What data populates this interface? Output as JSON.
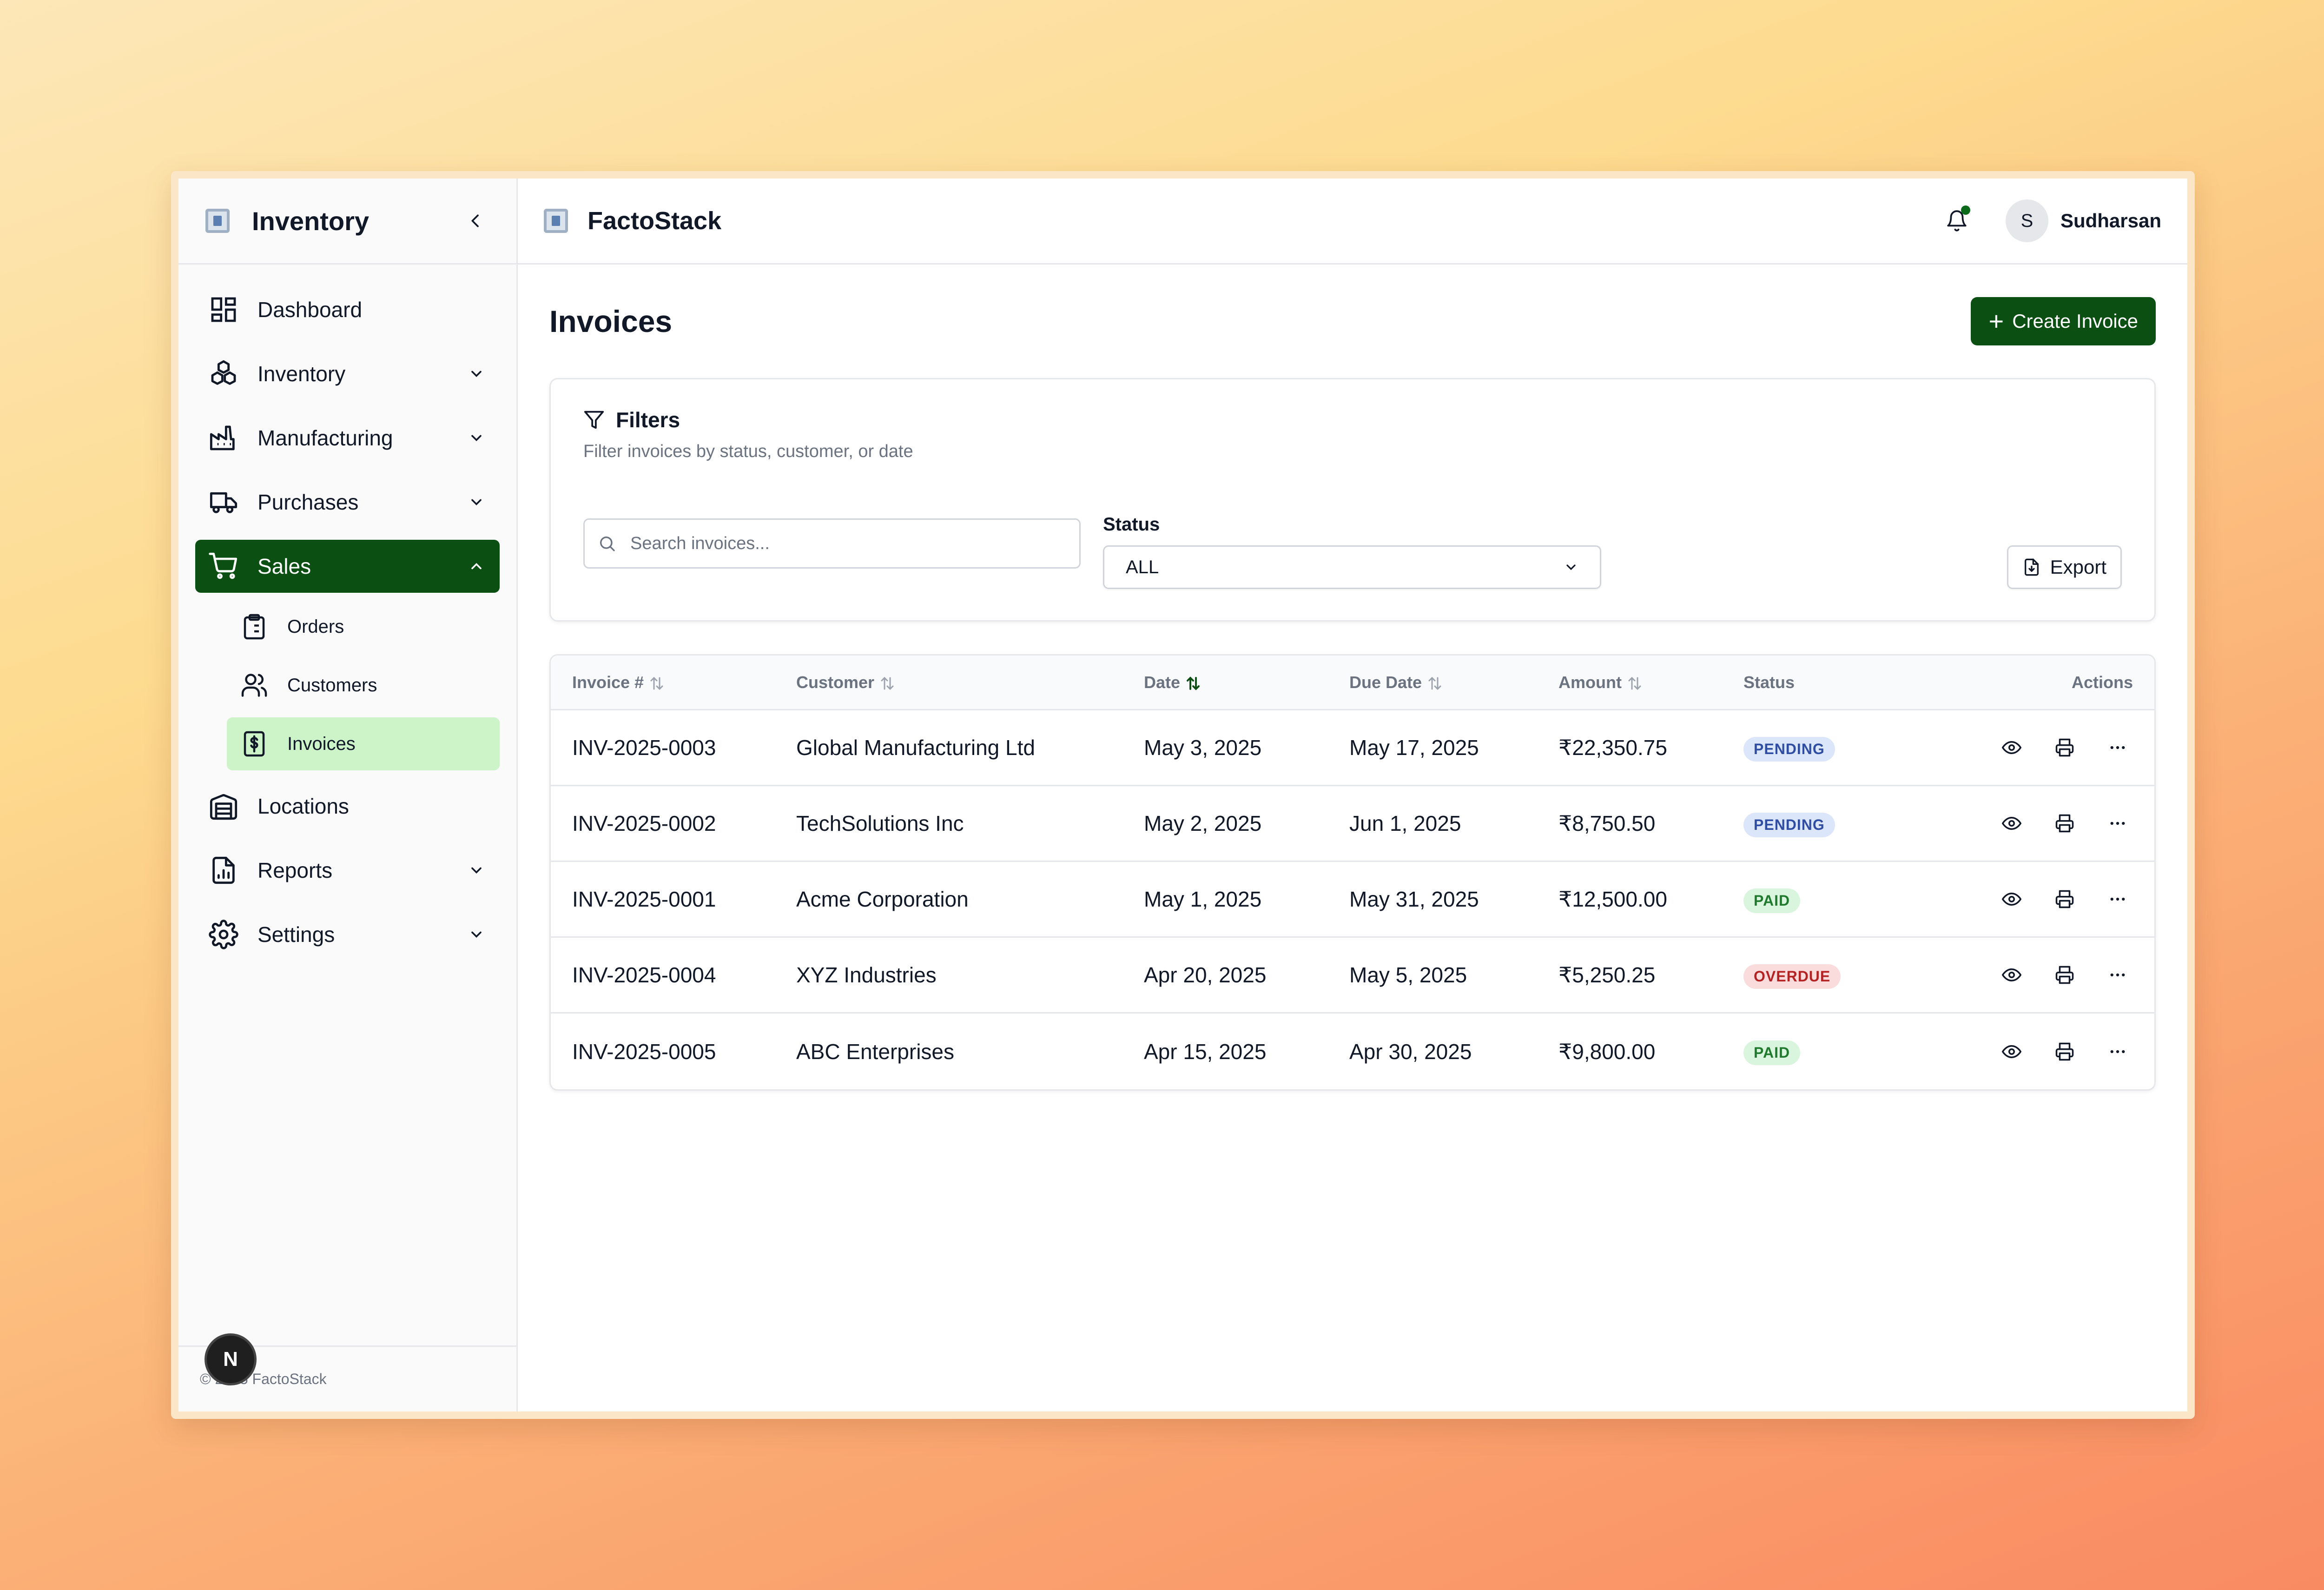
{
  "sidebar": {
    "title": "Inventory",
    "items": [
      {
        "label": "Dashboard"
      },
      {
        "label": "Inventory"
      },
      {
        "label": "Manufacturing"
      },
      {
        "label": "Purchases"
      },
      {
        "label": "Sales"
      },
      {
        "label": "Locations"
      },
      {
        "label": "Reports"
      },
      {
        "label": "Settings"
      }
    ],
    "sales_sub": [
      {
        "label": "Orders"
      },
      {
        "label": "Customers"
      },
      {
        "label": "Invoices"
      }
    ],
    "footer": "© 2025 FactoStack",
    "badge": "N"
  },
  "topbar": {
    "brand": "FactoStack",
    "avatar_initial": "S",
    "user_name": "Sudharsan"
  },
  "page": {
    "title": "Invoices",
    "create_button": "Create Invoice"
  },
  "filters": {
    "title": "Filters",
    "subtitle": "Filter invoices by status, customer, or date",
    "search_placeholder": "Search invoices...",
    "status_label": "Status",
    "status_value": "ALL",
    "export_label": "Export"
  },
  "table": {
    "headers": [
      "Invoice #",
      "Customer",
      "Date",
      "Due Date",
      "Amount",
      "Status",
      "Actions"
    ],
    "rows": [
      {
        "invoice": "INV-2025-0003",
        "customer": "Global Manufacturing Ltd",
        "date": "May 3, 2025",
        "due": "May 17, 2025",
        "amount": "₹22,350.75",
        "status": "PENDING"
      },
      {
        "invoice": "INV-2025-0002",
        "customer": "TechSolutions Inc",
        "date": "May 2, 2025",
        "due": "Jun 1, 2025",
        "amount": "₹8,750.50",
        "status": "PENDING"
      },
      {
        "invoice": "INV-2025-0001",
        "customer": "Acme Corporation",
        "date": "May 1, 2025",
        "due": "May 31, 2025",
        "amount": "₹12,500.00",
        "status": "PAID"
      },
      {
        "invoice": "INV-2025-0004",
        "customer": "XYZ Industries",
        "date": "Apr 20, 2025",
        "due": "May 5, 2025",
        "amount": "₹5,250.25",
        "status": "OVERDUE"
      },
      {
        "invoice": "INV-2025-0005",
        "customer": "ABC Enterprises",
        "date": "Apr 15, 2025",
        "due": "Apr 30, 2025",
        "amount": "₹9,800.00",
        "status": "PAID"
      }
    ]
  },
  "colors": {
    "primary": "#0b4f12",
    "selected_bg": "#cdf3c9",
    "pending": "#2f4ea3",
    "paid": "#1f7a2e",
    "overdue": "#b42323"
  }
}
